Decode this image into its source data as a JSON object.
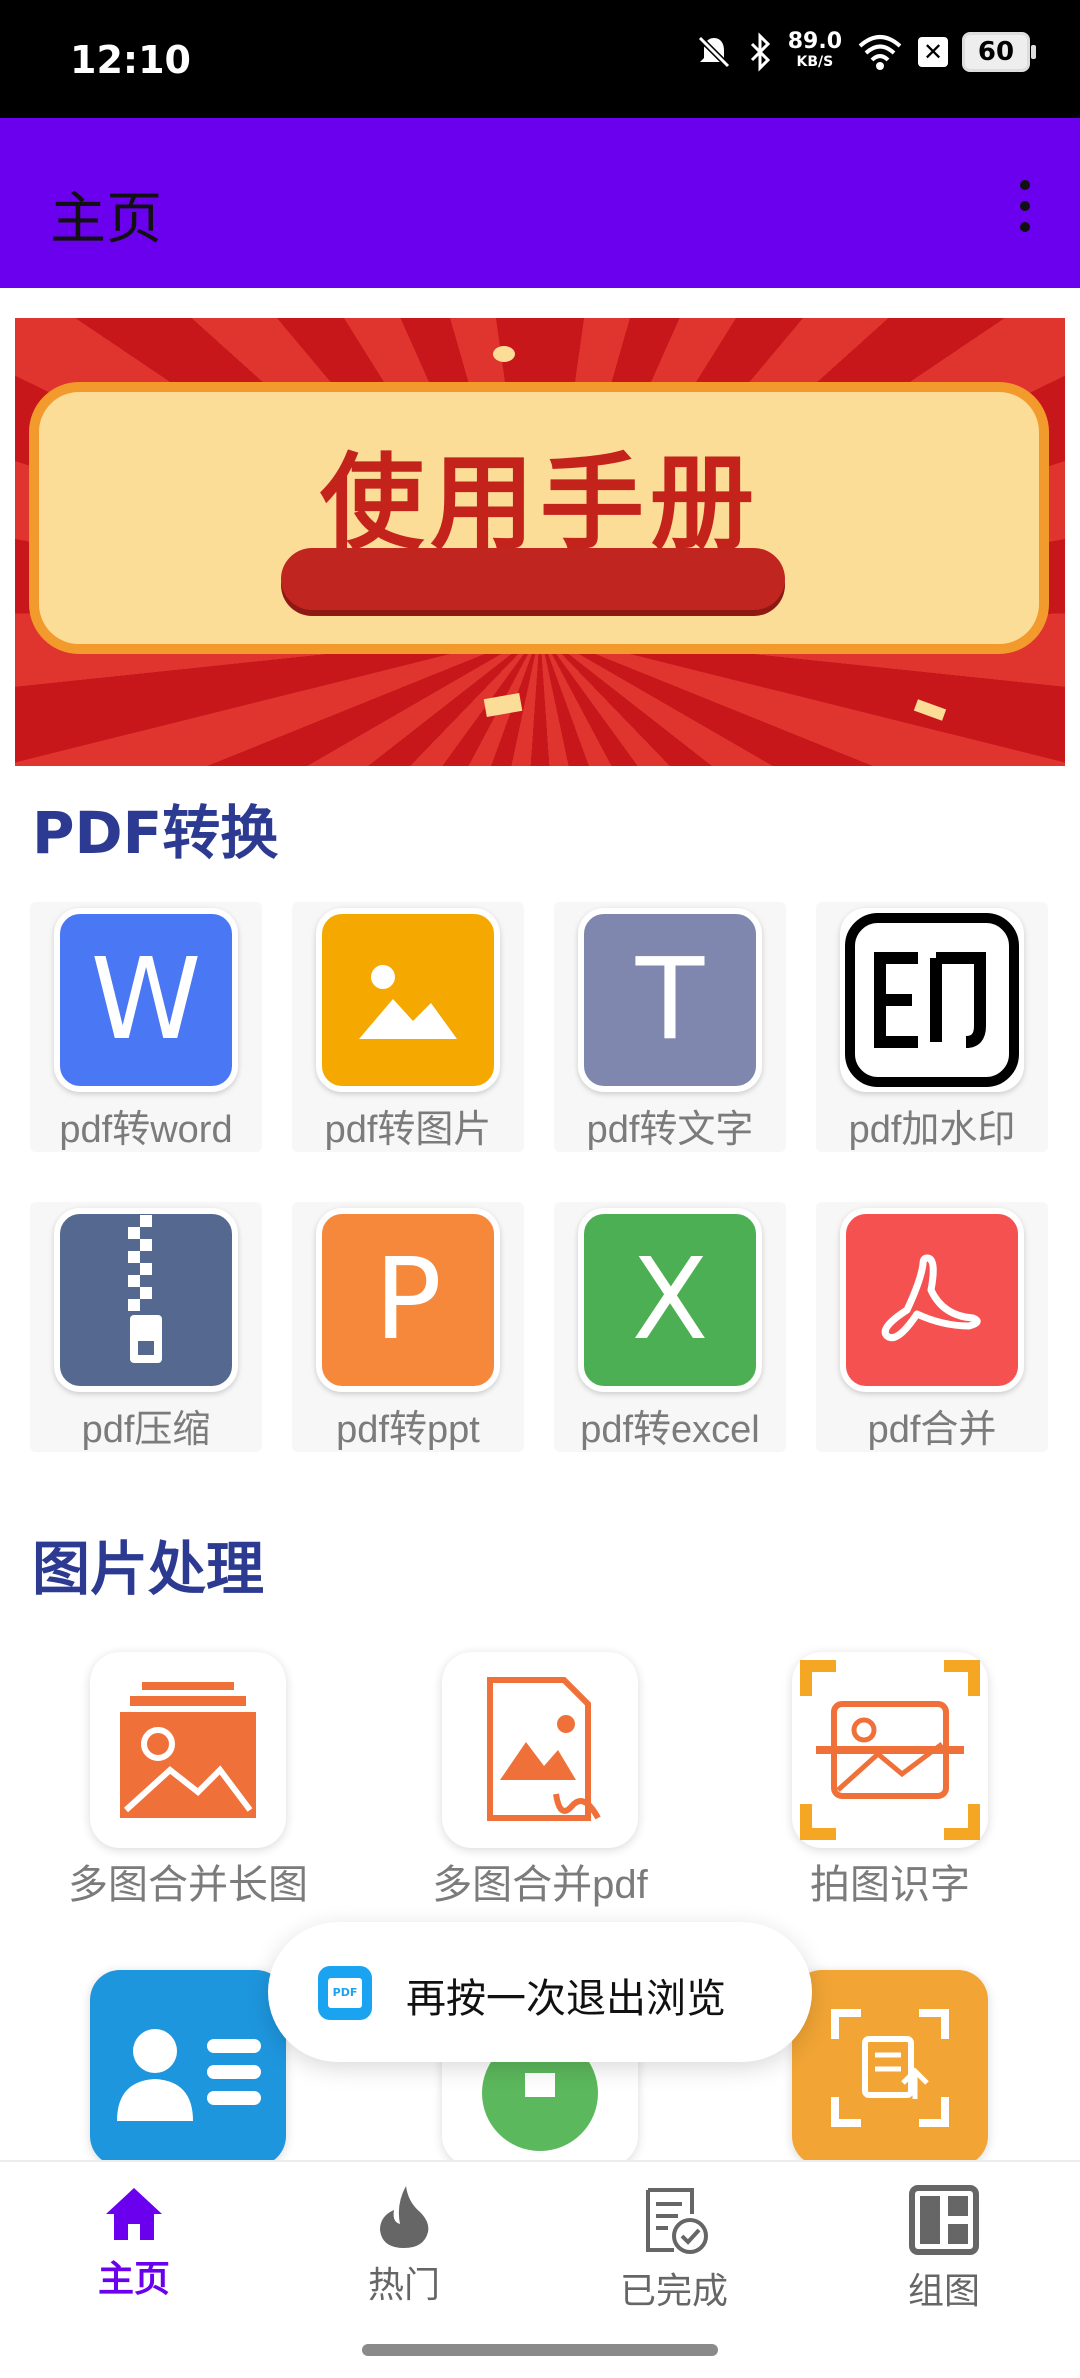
{
  "status_bar": {
    "time": "12:10",
    "net_speed": "89.0",
    "net_unit": "KB/S",
    "battery": "60"
  },
  "app_bar": {
    "title": "主页"
  },
  "banner": {
    "title": "使用手册"
  },
  "sections": {
    "pdf": {
      "title": "PDF转换",
      "tools": [
        {
          "label": "pdf转word",
          "icon": "word-icon",
          "color": "#4a78f4",
          "glyph": "W"
        },
        {
          "label": "pdf转图片",
          "icon": "image-icon",
          "color": "#f5a800",
          "glyph": ""
        },
        {
          "label": "pdf转文字",
          "icon": "text-icon",
          "color": "#7f87ae",
          "glyph": "T"
        },
        {
          "label": "pdf加水印",
          "icon": "watermark-icon",
          "color": "#ffffff",
          "glyph": ""
        },
        {
          "label": "pdf压缩",
          "icon": "zip-icon",
          "color": "#55688f",
          "glyph": ""
        },
        {
          "label": "pdf转ppt",
          "icon": "ppt-icon",
          "color": "#f5883b",
          "glyph": "P"
        },
        {
          "label": "pdf转excel",
          "icon": "excel-icon",
          "color": "#4daf53",
          "glyph": "X"
        },
        {
          "label": "pdf合并",
          "icon": "acrobat-icon",
          "color": "#f55150",
          "glyph": ""
        }
      ]
    },
    "image": {
      "title": "图片处理",
      "tools": [
        {
          "label": "多图合并长图",
          "icon": "gallery-icon"
        },
        {
          "label": "多图合并pdf",
          "icon": "image-pdf-icon"
        },
        {
          "label": "拍图识字",
          "icon": "scan-image-icon"
        }
      ]
    }
  },
  "toast": {
    "text": "再按一次退出浏览"
  },
  "bottom_nav": {
    "items": [
      {
        "label": "主页",
        "icon": "home-icon",
        "active": true
      },
      {
        "label": "热门",
        "icon": "flame-icon",
        "active": false
      },
      {
        "label": "已完成",
        "icon": "done-icon",
        "active": false
      },
      {
        "label": "组图",
        "icon": "grid-icon",
        "active": false
      }
    ]
  },
  "colors": {
    "accent": "#6a00ee",
    "section_title": "#2c3a91"
  }
}
